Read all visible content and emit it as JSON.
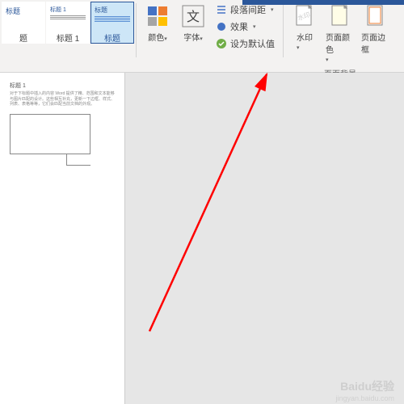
{
  "ribbon": {
    "styles": {
      "item1": {
        "name": "题",
        "preview": "标题"
      },
      "item2": {
        "name": "标题 1",
        "preview": "标题 1"
      },
      "item3": {
        "name": "标题",
        "preview": "标题"
      }
    },
    "formatting": {
      "color_label": "颜色",
      "font_label": "字体",
      "paragraph_spacing": "段落间距",
      "effects": "效果",
      "set_default": "设为默认值"
    },
    "page_background": {
      "group_label": "页面背景",
      "watermark": "水印",
      "page_color": "页面颜色",
      "page_border": "页面边框"
    }
  },
  "document": {
    "heading": "标题 1",
    "body": "对于下标题中插入的内容 Word 提供了精、范围和文本能够与图片匹配的设计。这些相互补充，更新一下边框、样式、列表、表格等等，它们会匹配当前文档的外观。"
  },
  "watermark": {
    "main": "Baidu经验",
    "sub": "jingyan.baidu.com"
  }
}
